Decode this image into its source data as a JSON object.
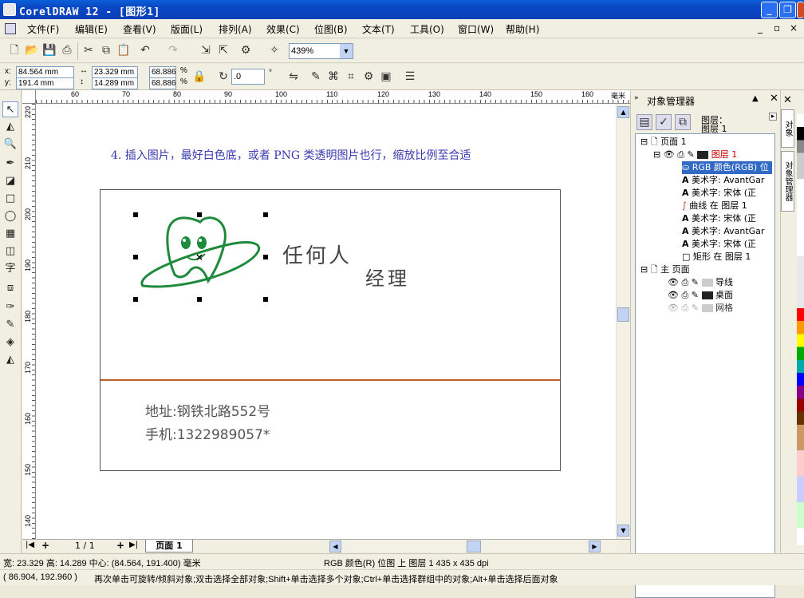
{
  "window": {
    "title": "CorelDRAW 12 - [图形1]",
    "buttons": {
      "minimize": "_",
      "restore": "❐",
      "close": "✕"
    }
  },
  "menu": {
    "items": [
      "文件(F)",
      "编辑(E)",
      "查看(V)",
      "版面(L)",
      "排列(A)",
      "效果(C)",
      "位图(B)",
      "文本(T)",
      "工具(O)",
      "窗口(W)",
      "帮助(H)"
    ],
    "mdi_controls": [
      "_",
      "▫",
      "×"
    ]
  },
  "toolbar": {
    "zoom_value": "439%"
  },
  "property_bar": {
    "x_value": "84.564 mm",
    "y_value": "191.4 mm",
    "width_value": "23.329 mm",
    "height_value": "14.289 mm",
    "scale_x": "68.886",
    "scale_y": "68.886",
    "percent_symbol": "%",
    "rotation_value": ".0",
    "degree_symbol": "°",
    "x_label": "x:",
    "y_label": "y:"
  },
  "rulers": {
    "unit": "毫米",
    "h_ticks": [
      "60",
      "70",
      "80",
      "90",
      "100",
      "110",
      "120",
      "130",
      "140",
      "150",
      "160"
    ],
    "v_ticks": [
      "220",
      "210",
      "200",
      "190",
      "180",
      "170",
      "160",
      "150",
      "140"
    ]
  },
  "canvas": {
    "instruction": "4. 插入图片，最好白色底，或者 PNG 类透明图片也行，缩放比例至合适",
    "card": {
      "name": "任何人",
      "title": "经理",
      "address": "地址:钢铁北路552号",
      "phone": "手机:1322989057*",
      "divider_color": "#c0602a"
    },
    "logo_color": "#1e8a3c"
  },
  "page_tabs": {
    "counter": "1 / 1",
    "active_tab": "页面 1"
  },
  "object_manager": {
    "title": "对象管理器",
    "header_layer_label": "图层：",
    "header_layer_value": "图层 1",
    "tree": [
      {
        "text": "页面 1"
      },
      {
        "text": "图层 1"
      },
      {
        "text": "RGB 颜色(RGB) 位"
      },
      {
        "text": "美术字: AvantGar"
      },
      {
        "text": "美术字: 宋体 (正"
      },
      {
        "text": "曲线 在 图层 1"
      },
      {
        "text": "美术字: 宋体 (正"
      },
      {
        "text": "美术字: AvantGar"
      },
      {
        "text": "美术字: 宋体 (正"
      },
      {
        "text": "矩形 在 图层 1"
      },
      {
        "text": "主 页面"
      },
      {
        "text": "导线"
      },
      {
        "text": "桌面"
      },
      {
        "text": "网格"
      }
    ],
    "layer_color": "#cc0000"
  },
  "right_dock": {
    "tab1": "对象",
    "tab2": "对象管理器"
  },
  "status": {
    "line1_left": "宽: 23.329  高: 14.289  中心: (84.564, 191.400)  毫米",
    "line1_center": "RGB 颜色(R) 位图 上 图层 1 435 x 435 dpi",
    "coords": "( 86.904, 192.960 )",
    "hint": "再次单击可旋转/倾斜对象;双击选择全部对象;Shift+单击选择多个对象;Ctrl+单击选择群组中的对象;Alt+单击选择后面对象"
  }
}
